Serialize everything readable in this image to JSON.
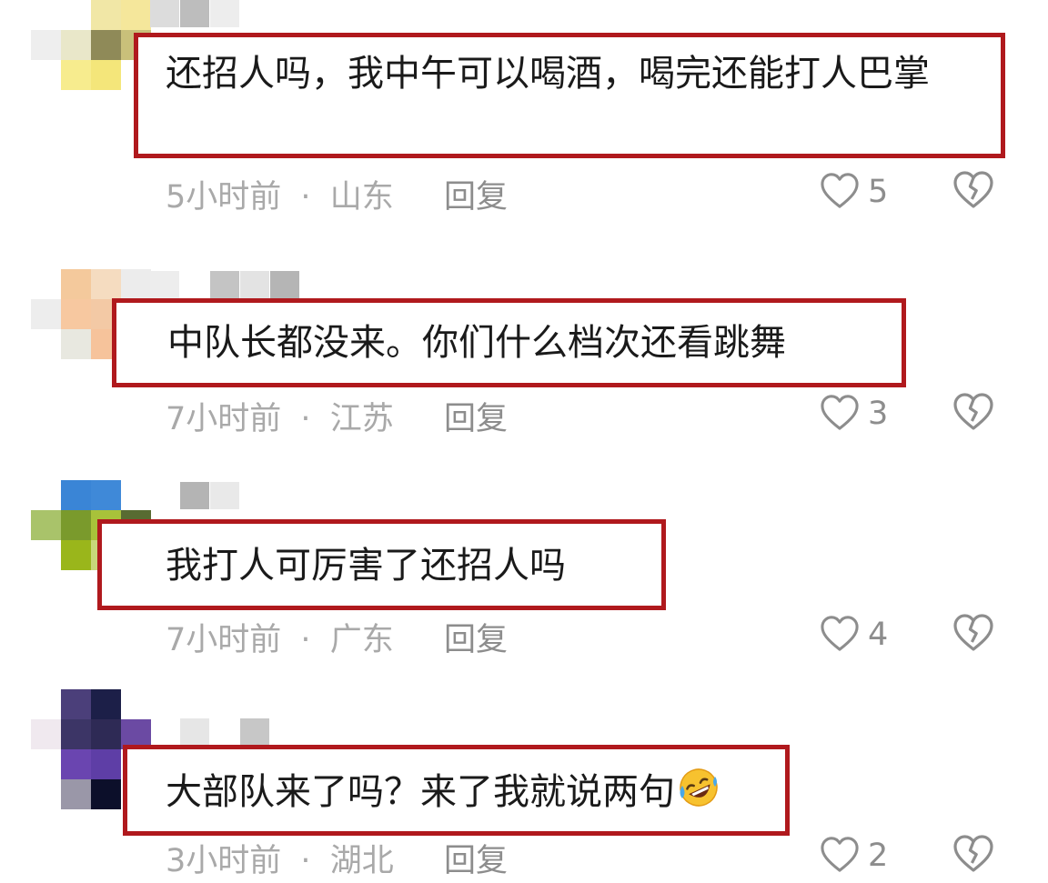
{
  "comments": [
    {
      "text": "还招人吗，我中午可以喝酒，喝完还能打人巴掌",
      "time": "5小时前",
      "separator": "·",
      "location": "山东",
      "reply_label": "回复",
      "likes": "5"
    },
    {
      "text": "中队长都没来。你们什么档次还看跳舞",
      "time": "7小时前",
      "separator": "·",
      "location": "江苏",
      "reply_label": "回复",
      "likes": "3"
    },
    {
      "text": "我打人可厉害了还招人吗",
      "time": "7小时前",
      "separator": "·",
      "location": "广东",
      "reply_label": "回复",
      "likes": "4"
    },
    {
      "text": "大部队来了吗？来了我就说两句",
      "emoji": "rolling-on-floor-laughing-emoji",
      "time": "3小时前",
      "separator": "·",
      "location": "湖北",
      "reply_label": "回复",
      "likes": "2"
    }
  ],
  "colors": {
    "highlight_border": "#b0191d",
    "meta_text": "#a9a9a9",
    "comment_text": "#1a1a1a",
    "icon_stroke": "#8d8d8d"
  },
  "icons": {
    "like": "heart-icon",
    "dislike": "broken-heart-icon"
  }
}
